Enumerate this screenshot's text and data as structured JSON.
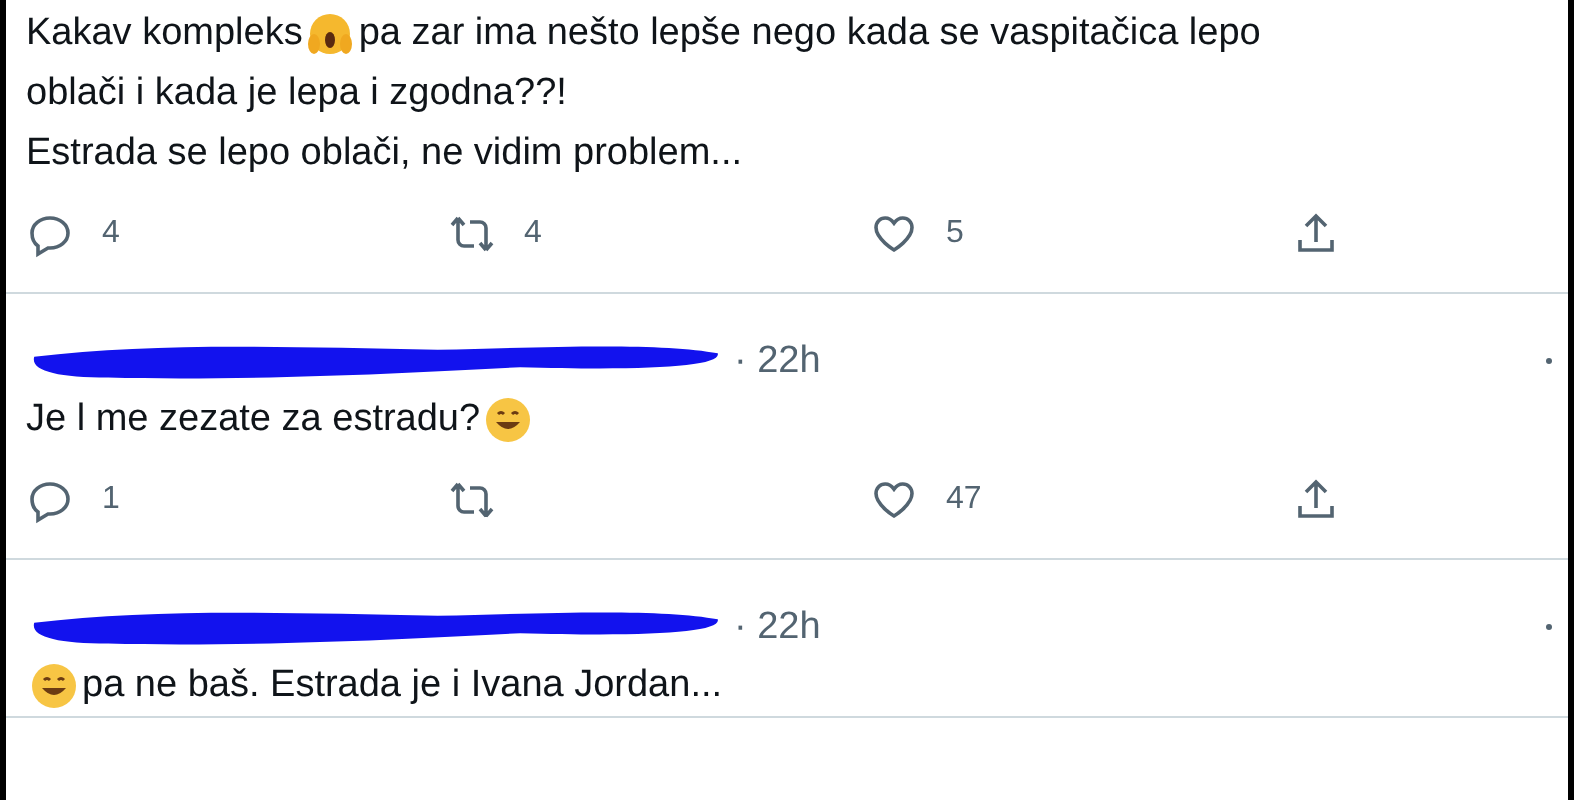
{
  "tweet": {
    "lines": [
      [
        {
          "kind": "text",
          "text": "Kakav kompleks"
        },
        {
          "kind": "scream"
        },
        {
          "kind": "text",
          "text": "pa zar ima nešto lepše nego kada se vaspitačica lepo"
        }
      ],
      [
        {
          "kind": "text",
          "text": "oblači i kada je lepa i zgodna??!"
        }
      ],
      [
        {
          "kind": "text",
          "text": "Estrada se lepo oblači, ne vidim problem..."
        }
      ]
    ],
    "actions": [
      {
        "kind": "reply",
        "count": "4"
      },
      {
        "kind": "retweet",
        "count": "4"
      },
      {
        "kind": "like",
        "count": "5"
      },
      {
        "kind": "share"
      }
    ]
  },
  "replies": [
    {
      "author_redacted": true,
      "time": "· 22h",
      "lines": [
        [
          {
            "kind": "text",
            "text": "Je l me zezate za estradu?"
          },
          {
            "kind": "grin"
          }
        ]
      ],
      "actions": [
        {
          "kind": "reply",
          "count": "1"
        },
        {
          "kind": "retweet"
        },
        {
          "kind": "like",
          "count": "47"
        },
        {
          "kind": "share"
        }
      ]
    },
    {
      "author_redacted": true,
      "time": "· 22h",
      "lines": [
        [
          {
            "kind": "grin"
          },
          {
            "kind": "text",
            "text": "pa ne baš. Estrada je i Ivana Jordan..."
          }
        ]
      ]
    }
  ]
}
